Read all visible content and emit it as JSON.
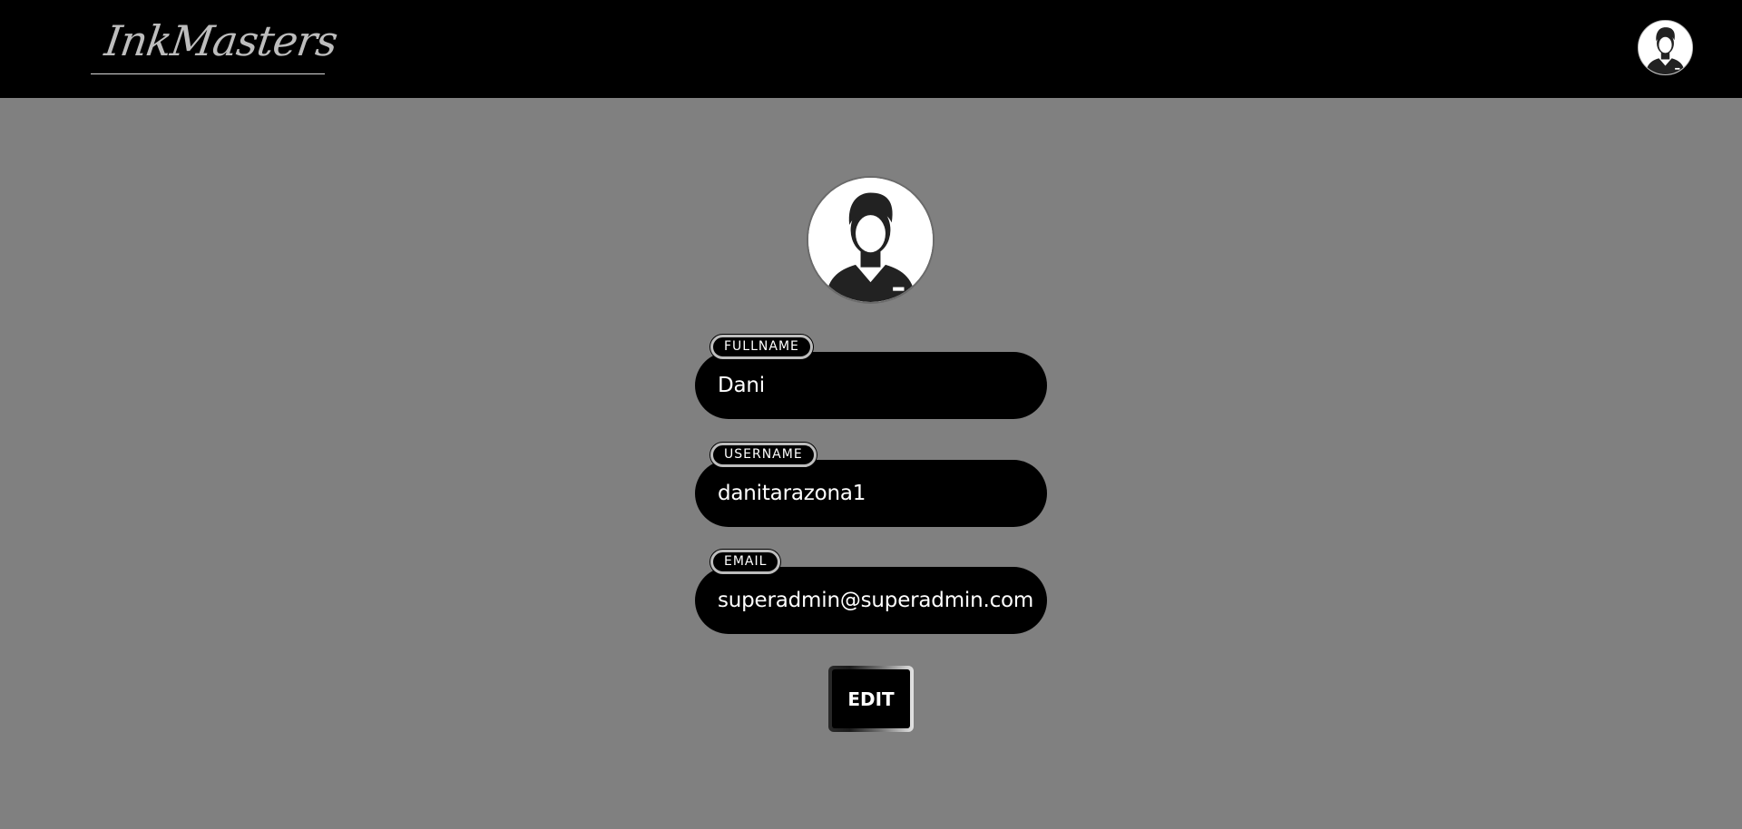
{
  "header": {
    "brand": "InkMasters",
    "avatar_icon": "user-avatar-icon"
  },
  "profile": {
    "avatar_icon": "user-avatar-icon",
    "fields": [
      {
        "label": "FULLNAME",
        "value": "Dani"
      },
      {
        "label": "USERNAME",
        "value": "danitarazona1"
      },
      {
        "label": "EMAIL",
        "value": "superadmin@superadmin.com"
      }
    ],
    "edit_label": "EDIT"
  },
  "colors": {
    "header_bg": "#000000",
    "page_bg": "#808080",
    "field_bg": "#000000",
    "text": "#ffffff"
  }
}
